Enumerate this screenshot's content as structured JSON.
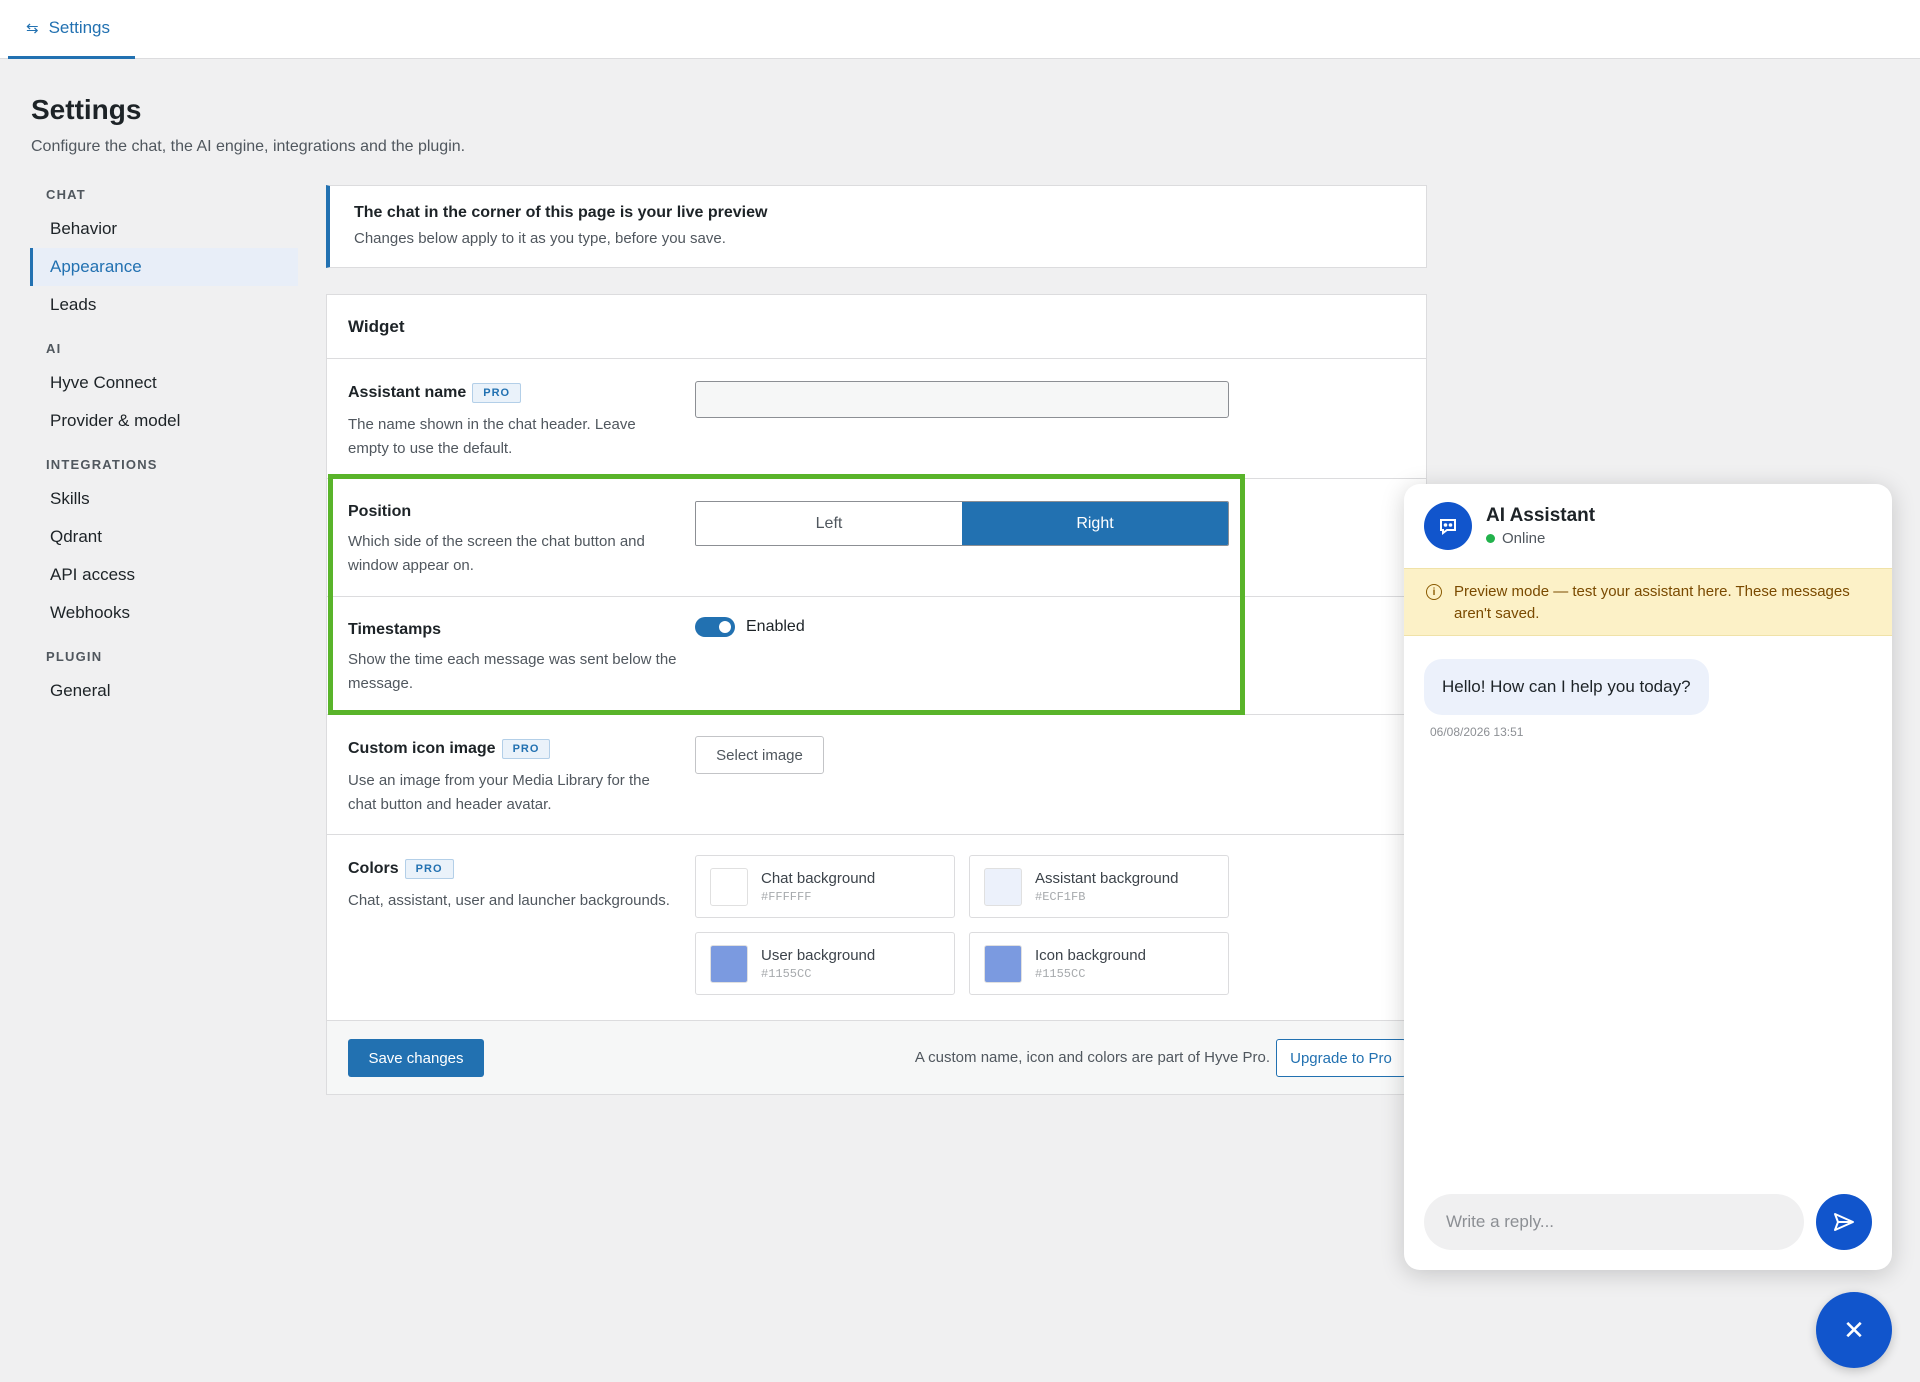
{
  "topbar": {
    "tab_label": "Settings",
    "tab_icon": "sliders-icon"
  },
  "page": {
    "title": "Settings",
    "subtitle": "Configure the chat, the AI engine, integrations and the plugin."
  },
  "sidebar": {
    "groups": [
      {
        "label": "CHAT",
        "items": [
          "Behavior",
          "Appearance",
          "Leads"
        ]
      },
      {
        "label": "AI",
        "items": [
          "Hyve Connect",
          "Provider & model"
        ]
      },
      {
        "label": "INTEGRATIONS",
        "items": [
          "Skills",
          "Qdrant",
          "API access",
          "Webhooks"
        ]
      },
      {
        "label": "PLUGIN",
        "items": [
          "General"
        ]
      }
    ],
    "active": "Appearance"
  },
  "notice": {
    "title": "The chat in the corner of this page is your live preview",
    "text": "Changes below apply to it as you type, before you save."
  },
  "widget": {
    "heading": "Widget",
    "pro_badge": "PRO",
    "assistant_name": {
      "label": "Assistant name",
      "desc": "The name shown in the chat header. Leave empty to use the default.",
      "value": ""
    },
    "position": {
      "label": "Position",
      "desc": "Which side of the screen the chat button and window appear on.",
      "options": [
        "Left",
        "Right"
      ],
      "selected": "Right"
    },
    "timestamps": {
      "label": "Timestamps",
      "desc": "Show the time each message was sent below the message.",
      "toggle_label": "Enabled",
      "enabled": true
    },
    "custom_icon": {
      "label": "Custom icon image",
      "desc": "Use an image from your Media Library for the chat button and header avatar.",
      "button": "Select image"
    },
    "colors": {
      "label": "Colors",
      "desc": "Chat, assistant, user and launcher backgrounds.",
      "swatches": [
        {
          "name": "Chat background",
          "hex": "#FFFFFF",
          "display": "#FFFFFF"
        },
        {
          "name": "Assistant background",
          "hex": "#ECF1FB",
          "display": "#ECF1FB"
        },
        {
          "name": "User background",
          "hex": "#7B9AE0",
          "display": "#1155CC"
        },
        {
          "name": "Icon background",
          "hex": "#7B9AE0",
          "display": "#1155CC"
        }
      ]
    },
    "footer": {
      "save": "Save changes",
      "note": "A custom name, icon and colors are part of Hyve Pro.",
      "upgrade": "Upgrade to Pro"
    }
  },
  "chat": {
    "title": "AI Assistant",
    "status": "Online",
    "preview_notice": "Preview mode — test your assistant here. These messages aren't saved.",
    "messages": [
      {
        "text": "Hello! How can I help you today?",
        "time": "06/08/2026 13:51"
      }
    ],
    "composer_placeholder": "Write a reply...",
    "launcher_icon": "close-icon",
    "accent": "#1155CC"
  },
  "colors": {
    "primary": "#2271b1",
    "highlight": "#59b42a"
  }
}
